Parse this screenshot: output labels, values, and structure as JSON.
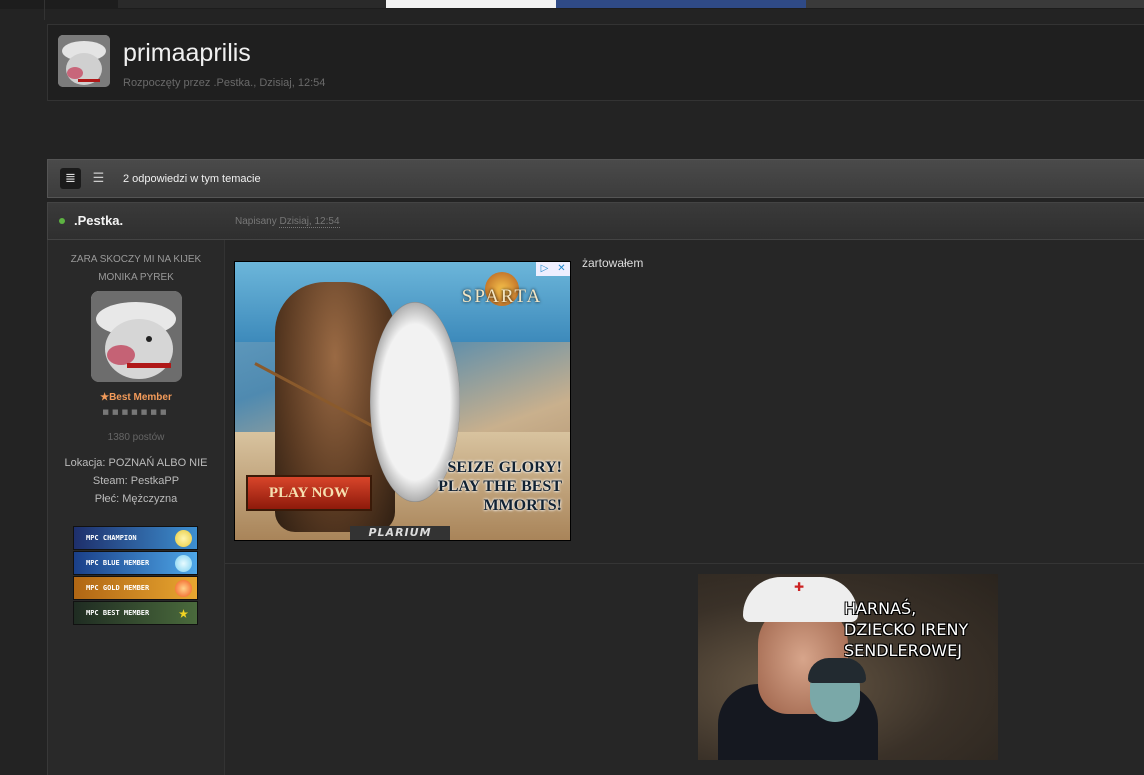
{
  "topic": {
    "title": "primaaprilis",
    "meta": "Rozpoczęty przez .Pestka., Dzisiaj, 12:54"
  },
  "topic_bar": {
    "reply_count": "2 odpowiedzi w tym temacie"
  },
  "post": {
    "author": ".Pestka.",
    "posted_label": "Napisany",
    "posted_date": "Dzisiaj, 12:54",
    "body_text": "żartowałem",
    "status_color": "#5db342"
  },
  "user": {
    "tagline_1": "ZARA SKOCZY MI NA KIJEK",
    "tagline_2": "MONIKA PYREK",
    "rank": "★Best Member",
    "pips": "■■■■■■■",
    "posts": "1380 postów",
    "location": "Lokacja: POZNAŃ ALBO NIE",
    "steam": "Steam: PestkaPP",
    "gender": "Płeć: Mężczyzna"
  },
  "badges": [
    {
      "label": "mpc champion",
      "color": "#1e2f6b",
      "icon_color": "#e7c93b"
    },
    {
      "label": "mpc blue member",
      "color": "#2460b8",
      "icon_color": "#7dd0f0"
    },
    {
      "label": "mpc gold member",
      "color": "#c97c16",
      "icon_color": "#f2561d"
    },
    {
      "label": "mpc best member",
      "color": "#2a3b2c",
      "icon_color": "#f2d422"
    }
  ],
  "ad": {
    "logo": "SPARTA",
    "tagline_1": "SEIZE GLORY!",
    "tagline_2": "PLAY THE BEST",
    "tagline_3": "MMORTS!",
    "cta": "PLAY NOW",
    "brand": "PLARIUM",
    "tag_icons": [
      "▷",
      "✕"
    ]
  },
  "meme": {
    "caption": "HARNAŚ,\nDZIECKO IRENY\nSENDLEROWEJ"
  },
  "icons": {
    "view_full": "≣",
    "view_compact": "☰"
  }
}
